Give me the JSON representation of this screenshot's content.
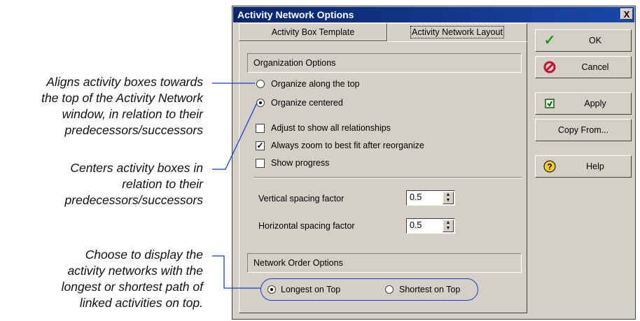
{
  "callouts": {
    "c1": [
      "Aligns activity boxes towards",
      "the top of the Activity Network",
      "window, in relation to their",
      "predecessors/successors"
    ],
    "c2": [
      "Centers activity boxes in",
      "relation to their",
      "predecessors/successors"
    ],
    "c3": [
      "Choose to display the",
      "activity networks with the",
      "longest or shortest path of",
      "linked activities on top."
    ]
  },
  "window": {
    "title": "Activity Network Options",
    "close": "X"
  },
  "tabs": [
    {
      "label": "Activity Box Template",
      "active": false
    },
    {
      "label": "Activity Network Layout",
      "active": true
    }
  ],
  "organization": {
    "header": "Organization Options",
    "radio_top": "Organize along the top",
    "radio_centered": "Organize centered",
    "selected": "centered",
    "check_adjust": "Adjust to show all relationships",
    "check_zoom": "Always zoom to best fit after reorganize",
    "check_progress": "Show progress",
    "checked": {
      "adjust": false,
      "zoom": true,
      "progress": false
    },
    "vertical_label": "Vertical spacing factor",
    "vertical_value": "0.5",
    "horizontal_label": "Horizontal spacing factor",
    "horizontal_value": "0.5"
  },
  "network_order": {
    "header": "Network Order Options",
    "longest": "Longest on Top",
    "shortest": "Shortest on Top",
    "selected": "longest"
  },
  "buttons": {
    "ok": "OK",
    "cancel": "Cancel",
    "apply": "Apply",
    "copy_from": "Copy From...",
    "help": "Help"
  },
  "icons": {
    "ok": "checkmark-icon",
    "cancel": "no-entry-icon",
    "apply": "apply-icon",
    "help": "question-icon"
  },
  "colors": {
    "titlebar": "#0a246a",
    "callout_line": "#1a3cc8",
    "dialog_face": "#d4d0c8"
  }
}
